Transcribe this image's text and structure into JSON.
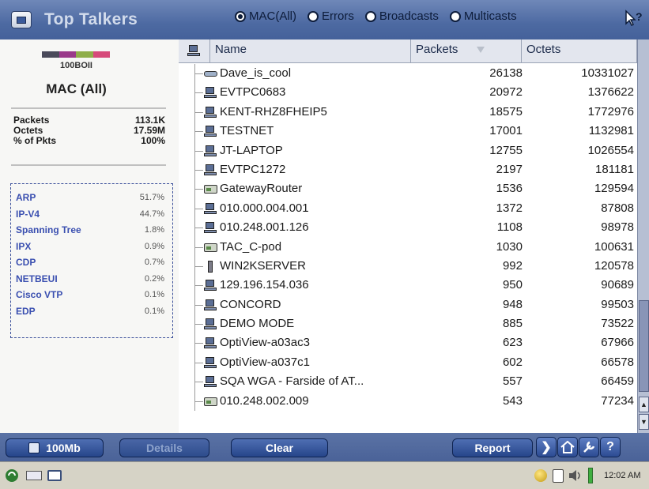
{
  "title": "Top Talkers",
  "filter_options": [
    {
      "label": "MAC(All)",
      "selected": true
    },
    {
      "label": "Errors",
      "selected": false
    },
    {
      "label": "Broadcasts",
      "selected": false
    },
    {
      "label": "Multicasts",
      "selected": false
    }
  ],
  "left": {
    "network_label": "100BOII",
    "filter_label": "MAC (All)",
    "stats": [
      {
        "label": "Packets",
        "value": "113.1K"
      },
      {
        "label": "Octets",
        "value": "17.59M"
      },
      {
        "label": "% of Pkts",
        "value": "100%"
      }
    ],
    "protocols": [
      {
        "name": "ARP",
        "pct": "51.7%"
      },
      {
        "name": "IP-V4",
        "pct": "44.7%"
      },
      {
        "name": "Spanning Tree",
        "pct": "1.8%"
      },
      {
        "name": "IPX",
        "pct": "0.9%"
      },
      {
        "name": "CDP",
        "pct": "0.7%"
      },
      {
        "name": "NETBEUI",
        "pct": "0.2%"
      },
      {
        "name": "Cisco VTP",
        "pct": "0.1%"
      },
      {
        "name": "EDP",
        "pct": "0.1%"
      }
    ],
    "colorbar": [
      "#4a4a5a",
      "#9a3a8a",
      "#8fae4a",
      "#d64a7a"
    ]
  },
  "table": {
    "columns": {
      "name": "Name",
      "packets": "Packets",
      "octets": "Octets"
    },
    "rows": [
      {
        "icon": "nic",
        "name": "Dave_is_cool",
        "packets": "26138",
        "octets": "10331027"
      },
      {
        "icon": "pc",
        "name": "EVTPC0683",
        "packets": "20972",
        "octets": "1376622"
      },
      {
        "icon": "pc",
        "name": "KENT-RHZ8FHEIP5",
        "packets": "18575",
        "octets": "1772976"
      },
      {
        "icon": "pc",
        "name": "TESTNET",
        "packets": "17001",
        "octets": "1132981"
      },
      {
        "icon": "pc",
        "name": "JT-LAPTOP",
        "packets": "12755",
        "octets": "1026554"
      },
      {
        "icon": "pc",
        "name": "EVTPC1272",
        "packets": "2197",
        "octets": "181181"
      },
      {
        "icon": "router",
        "name": "GatewayRouter",
        "packets": "1536",
        "octets": "129594"
      },
      {
        "icon": "pc",
        "name": "010.000.004.001",
        "packets": "1372",
        "octets": "87808"
      },
      {
        "icon": "pc",
        "name": "010.248.001.126",
        "packets": "1108",
        "octets": "98978"
      },
      {
        "icon": "router",
        "name": "TAC_C-pod",
        "packets": "1030",
        "octets": "100631"
      },
      {
        "icon": "server",
        "name": "WIN2KSERVER",
        "packets": "992",
        "octets": "120578"
      },
      {
        "icon": "pc",
        "name": "129.196.154.036",
        "packets": "950",
        "octets": "90689"
      },
      {
        "icon": "pc",
        "name": "CONCORD",
        "packets": "948",
        "octets": "99503"
      },
      {
        "icon": "pc",
        "name": "DEMO MODE",
        "packets": "885",
        "octets": "73522"
      },
      {
        "icon": "pc",
        "name": "OptiView-a03ac3",
        "packets": "623",
        "octets": "67966"
      },
      {
        "icon": "pc",
        "name": "OptiView-a037c1",
        "packets": "602",
        "octets": "66578"
      },
      {
        "icon": "pc",
        "name": "SQA WGA - Farside of AT...",
        "packets": "557",
        "octets": "66459"
      },
      {
        "icon": "router",
        "name": "010.248.002.009",
        "packets": "543",
        "octets": "77234"
      }
    ]
  },
  "bottom": {
    "speed_label": "100Mb",
    "details_label": "Details",
    "clear_label": "Clear",
    "report_label": "Report"
  },
  "taskbar": {
    "clock": "12:02 AM"
  }
}
